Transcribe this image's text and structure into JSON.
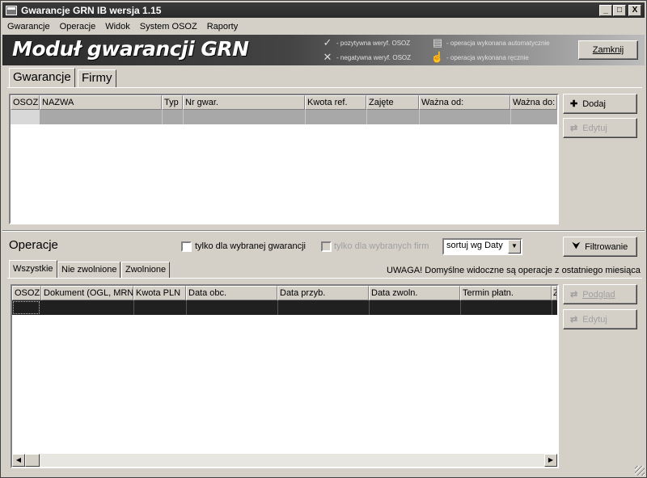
{
  "window": {
    "title": "Gwarancje GRN IB wersja 1.15",
    "controls": {
      "minimize": "_",
      "maximize": "□",
      "close": "X"
    }
  },
  "menu": [
    "Gwarancje",
    "Operacje",
    "Widok",
    "System OSOZ",
    "Raporty"
  ],
  "banner": {
    "title": "Moduł gwarancji GRN",
    "legend": {
      "positive": "- pozytywna weryf. OSOZ",
      "negative": "- negatywna weryf. OSOZ",
      "automatic": "- operacja wykonana automatycznie",
      "manual": "- operacja wykonana ręcznie"
    },
    "close_button": "Zamknij"
  },
  "top_tabs": [
    "Gwarancje",
    "Firmy"
  ],
  "guarantees": {
    "columns": [
      "OSOZ",
      "NAZWA",
      "Typ",
      "Nr gwar.",
      "Kwota ref.",
      "Zajęte",
      "Ważna od:",
      "Ważna do:"
    ],
    "add_button": "Dodaj",
    "edit_button": "Edytuj"
  },
  "operations": {
    "title": "Operacje",
    "only_selected_guarantee": "tylko dla wybranej gwarancji",
    "only_selected_firms": "tylko dla wybranych firm",
    "sort": "sortuj wg Daty",
    "filter_button": "Filtrowanie",
    "tabs": [
      "Wszystkie",
      "Nie zwolnione",
      "Zwolnione"
    ],
    "notice": "UWAGA! Domyślne widoczne są operacje z ostatniego miesiąca",
    "columns": [
      "OSOZ",
      "Dokument (OGL, MRN...",
      "Kwota PLN",
      "Data obc.",
      "Data przyb.",
      "Data zwoln.",
      "Termin płatn.",
      "Z"
    ],
    "preview_button": "Podgląd",
    "edit_button": "Edytuj"
  }
}
